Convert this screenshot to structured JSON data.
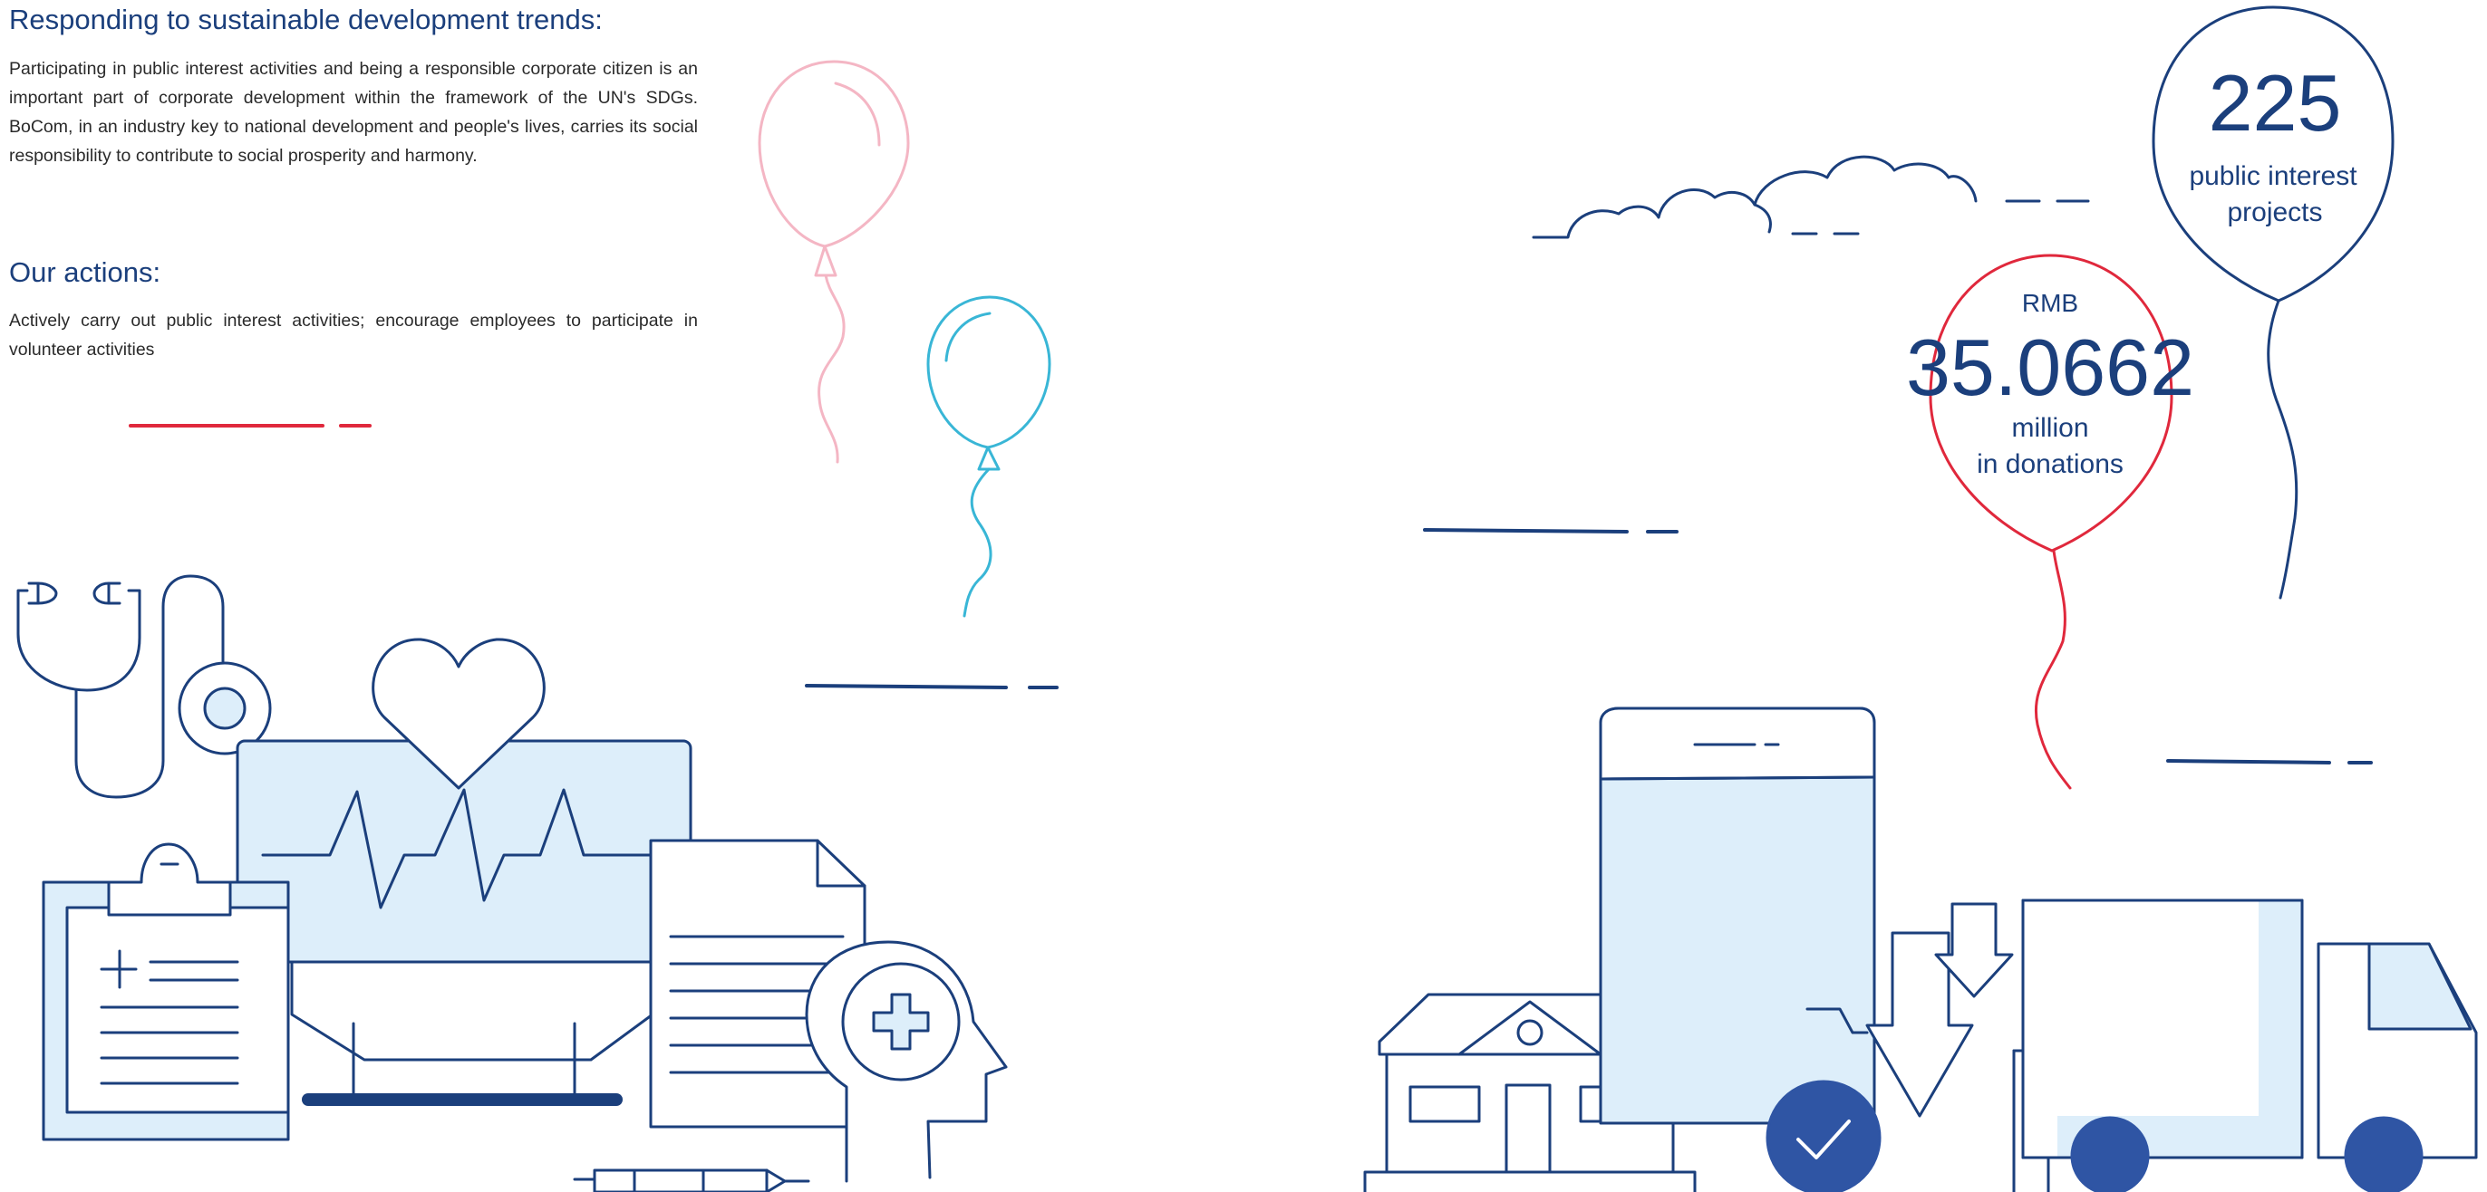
{
  "trends": {
    "heading": "Responding to sustainable development trends:",
    "paragraph": "Participating in public interest activities and being a responsible corporate citizen is an important part of corporate development within the framework of the UN's SDGs. BoCom, in an industry key to national development and people's lives, carries its social responsibility to contribute to social prosperity and harmony."
  },
  "actions": {
    "heading": "Our actions:",
    "paragraph": "Actively carry out public interest activities; encourage employees to participate in volunteer activities"
  },
  "stats": {
    "projects": {
      "value": "225",
      "line1": "public interest",
      "line2": "projects"
    },
    "donations": {
      "unit": "RMB",
      "value": "35.0662",
      "line1": "million",
      "line2": "in donations"
    }
  },
  "colors": {
    "navy": "#1b3f7c",
    "red": "#e0283c",
    "pink": "#f4b6c4",
    "cyan": "#39b6d6",
    "light_blue_fill": "#ddeefa",
    "accent_blue": "#2f55a4"
  },
  "icons": [
    "stethoscope-icon",
    "heart-icon",
    "heart-monitor-icon",
    "clipboard-icon",
    "document-icon",
    "head-medical-cross-icon",
    "syringe-icon",
    "balloon-icon",
    "cloud-icon",
    "smartphone-icon",
    "house-icon",
    "checkmark-icon",
    "download-arrow-icon",
    "delivery-truck-icon"
  ]
}
